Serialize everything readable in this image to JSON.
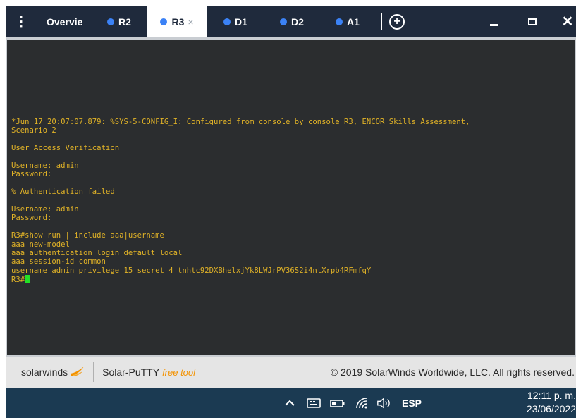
{
  "tabs": [
    {
      "label": "Overvie",
      "dot": false,
      "active": false
    },
    {
      "label": "R2",
      "dot": true,
      "active": false
    },
    {
      "label": "R3",
      "dot": true,
      "active": true
    },
    {
      "label": "D1",
      "dot": true,
      "active": false
    },
    {
      "label": "D2",
      "dot": true,
      "active": false
    },
    {
      "label": "A1",
      "dot": true,
      "active": false
    }
  ],
  "icons": {
    "menu": "kebab-menu-icon",
    "close_tab": "close-icon",
    "add_tab": "plus-circle-icon",
    "minimize": "minimize-icon",
    "maximize": "maximize-icon",
    "close_window": "close-icon"
  },
  "glyphs": {
    "menu": "⋮",
    "add": "+",
    "close": "×",
    "close_window": "✕"
  },
  "colors": {
    "tabbar": "#1f2a3c",
    "tab_dot": "#3b82f6",
    "terminal_bg": "#2b2d2f",
    "terminal_text": "#e0b227",
    "cursor": "#22e026",
    "footer_bg": "#e5e5e5",
    "taskbar_bg": "#1b3a52",
    "free_tool": "#f39200"
  },
  "terminal": {
    "lines": [
      "*Jun 17 20:07:07.879: %SYS-5-CONFIG_I: Configured from console by console R3, ENCOR Skills Assessment,",
      "Scenario 2",
      "",
      "User Access Verification",
      "",
      "Username: admin",
      "Password:",
      "",
      "% Authentication failed",
      "",
      "Username: admin",
      "Password:",
      "",
      "R3#show run | include aaa|username",
      "aaa new-model",
      "aaa authentication login default local",
      "aaa session-id common",
      "username admin privilege 15 secret 4 tnhtc92DXBhelxjYk8LWJrPV36S2i4ntXrpb4RFmfqY"
    ],
    "prompt": "R3#"
  },
  "footer": {
    "brand": "solarwinds",
    "product": "Solar-PuTTY",
    "free_tool": "free tool",
    "copyright": "© 2019 SolarWinds Worldwide, LLC. All rights reserved."
  },
  "taskbar": {
    "language": "ESP",
    "time": "12:11 p. m.",
    "date": "23/06/2022",
    "tray_icons": [
      "chevron-up-icon",
      "keyboard-icon",
      "battery-icon",
      "wifi-icon",
      "volume-icon"
    ]
  }
}
